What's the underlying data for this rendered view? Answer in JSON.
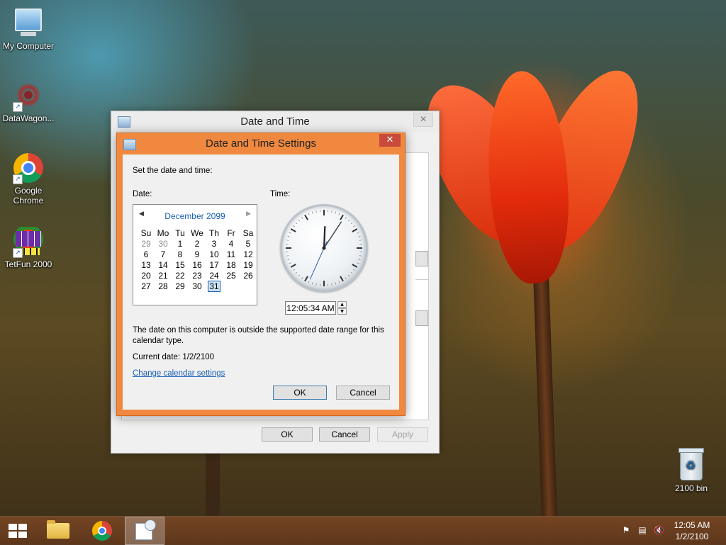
{
  "desktop": {
    "icons": [
      {
        "label": "My Computer"
      },
      {
        "label": "DataWagon..."
      },
      {
        "label": "Google Chrome"
      },
      {
        "label": "TetFun 2000"
      }
    ],
    "recycle_bin_label": "2100 bin"
  },
  "outer_window": {
    "title": "Date and Time",
    "close_glyph": "✕",
    "buttons": {
      "ok": "OK",
      "cancel": "Cancel",
      "apply": "Apply"
    }
  },
  "dialog": {
    "title": "Date and Time Settings",
    "close_glyph": "✕",
    "instruction": "Set the date and time:",
    "date_label": "Date:",
    "time_label": "Time:",
    "calendar": {
      "month_title": "December 2099",
      "prev_glyph": "◀",
      "next_glyph": "▶",
      "weekdays": [
        "Su",
        "Mo",
        "Tu",
        "We",
        "Th",
        "Fr",
        "Sa"
      ],
      "weeks": [
        [
          "29",
          "30",
          "1",
          "2",
          "3",
          "4",
          "5"
        ],
        [
          "6",
          "7",
          "8",
          "9",
          "10",
          "11",
          "12"
        ],
        [
          "13",
          "14",
          "15",
          "16",
          "17",
          "18",
          "19"
        ],
        [
          "20",
          "21",
          "22",
          "23",
          "24",
          "25",
          "26"
        ],
        [
          "27",
          "28",
          "29",
          "30",
          "31",
          "",
          ""
        ]
      ],
      "selected_day": "31"
    },
    "clock": {
      "hour": 12,
      "minute": 5,
      "second": 34
    },
    "time_value": "12:05:34 AM",
    "warning_line1": "The date on this computer is outside the supported date range for this",
    "warning_line2": "calendar type.",
    "current_date": "Current date: 1/2/2100",
    "change_link": "Change calendar settings",
    "ok": "OK",
    "cancel": "Cancel"
  },
  "taskbar": {
    "clock_time": "12:05 AM",
    "clock_date": "1/2/2100",
    "tray_icons": [
      "flag-icon",
      "network-icon",
      "volume-muted-icon"
    ]
  },
  "colors": {
    "dialog_frame": "#f0893f",
    "close_red": "#c74a3c",
    "link_blue": "#1a5fb4"
  }
}
